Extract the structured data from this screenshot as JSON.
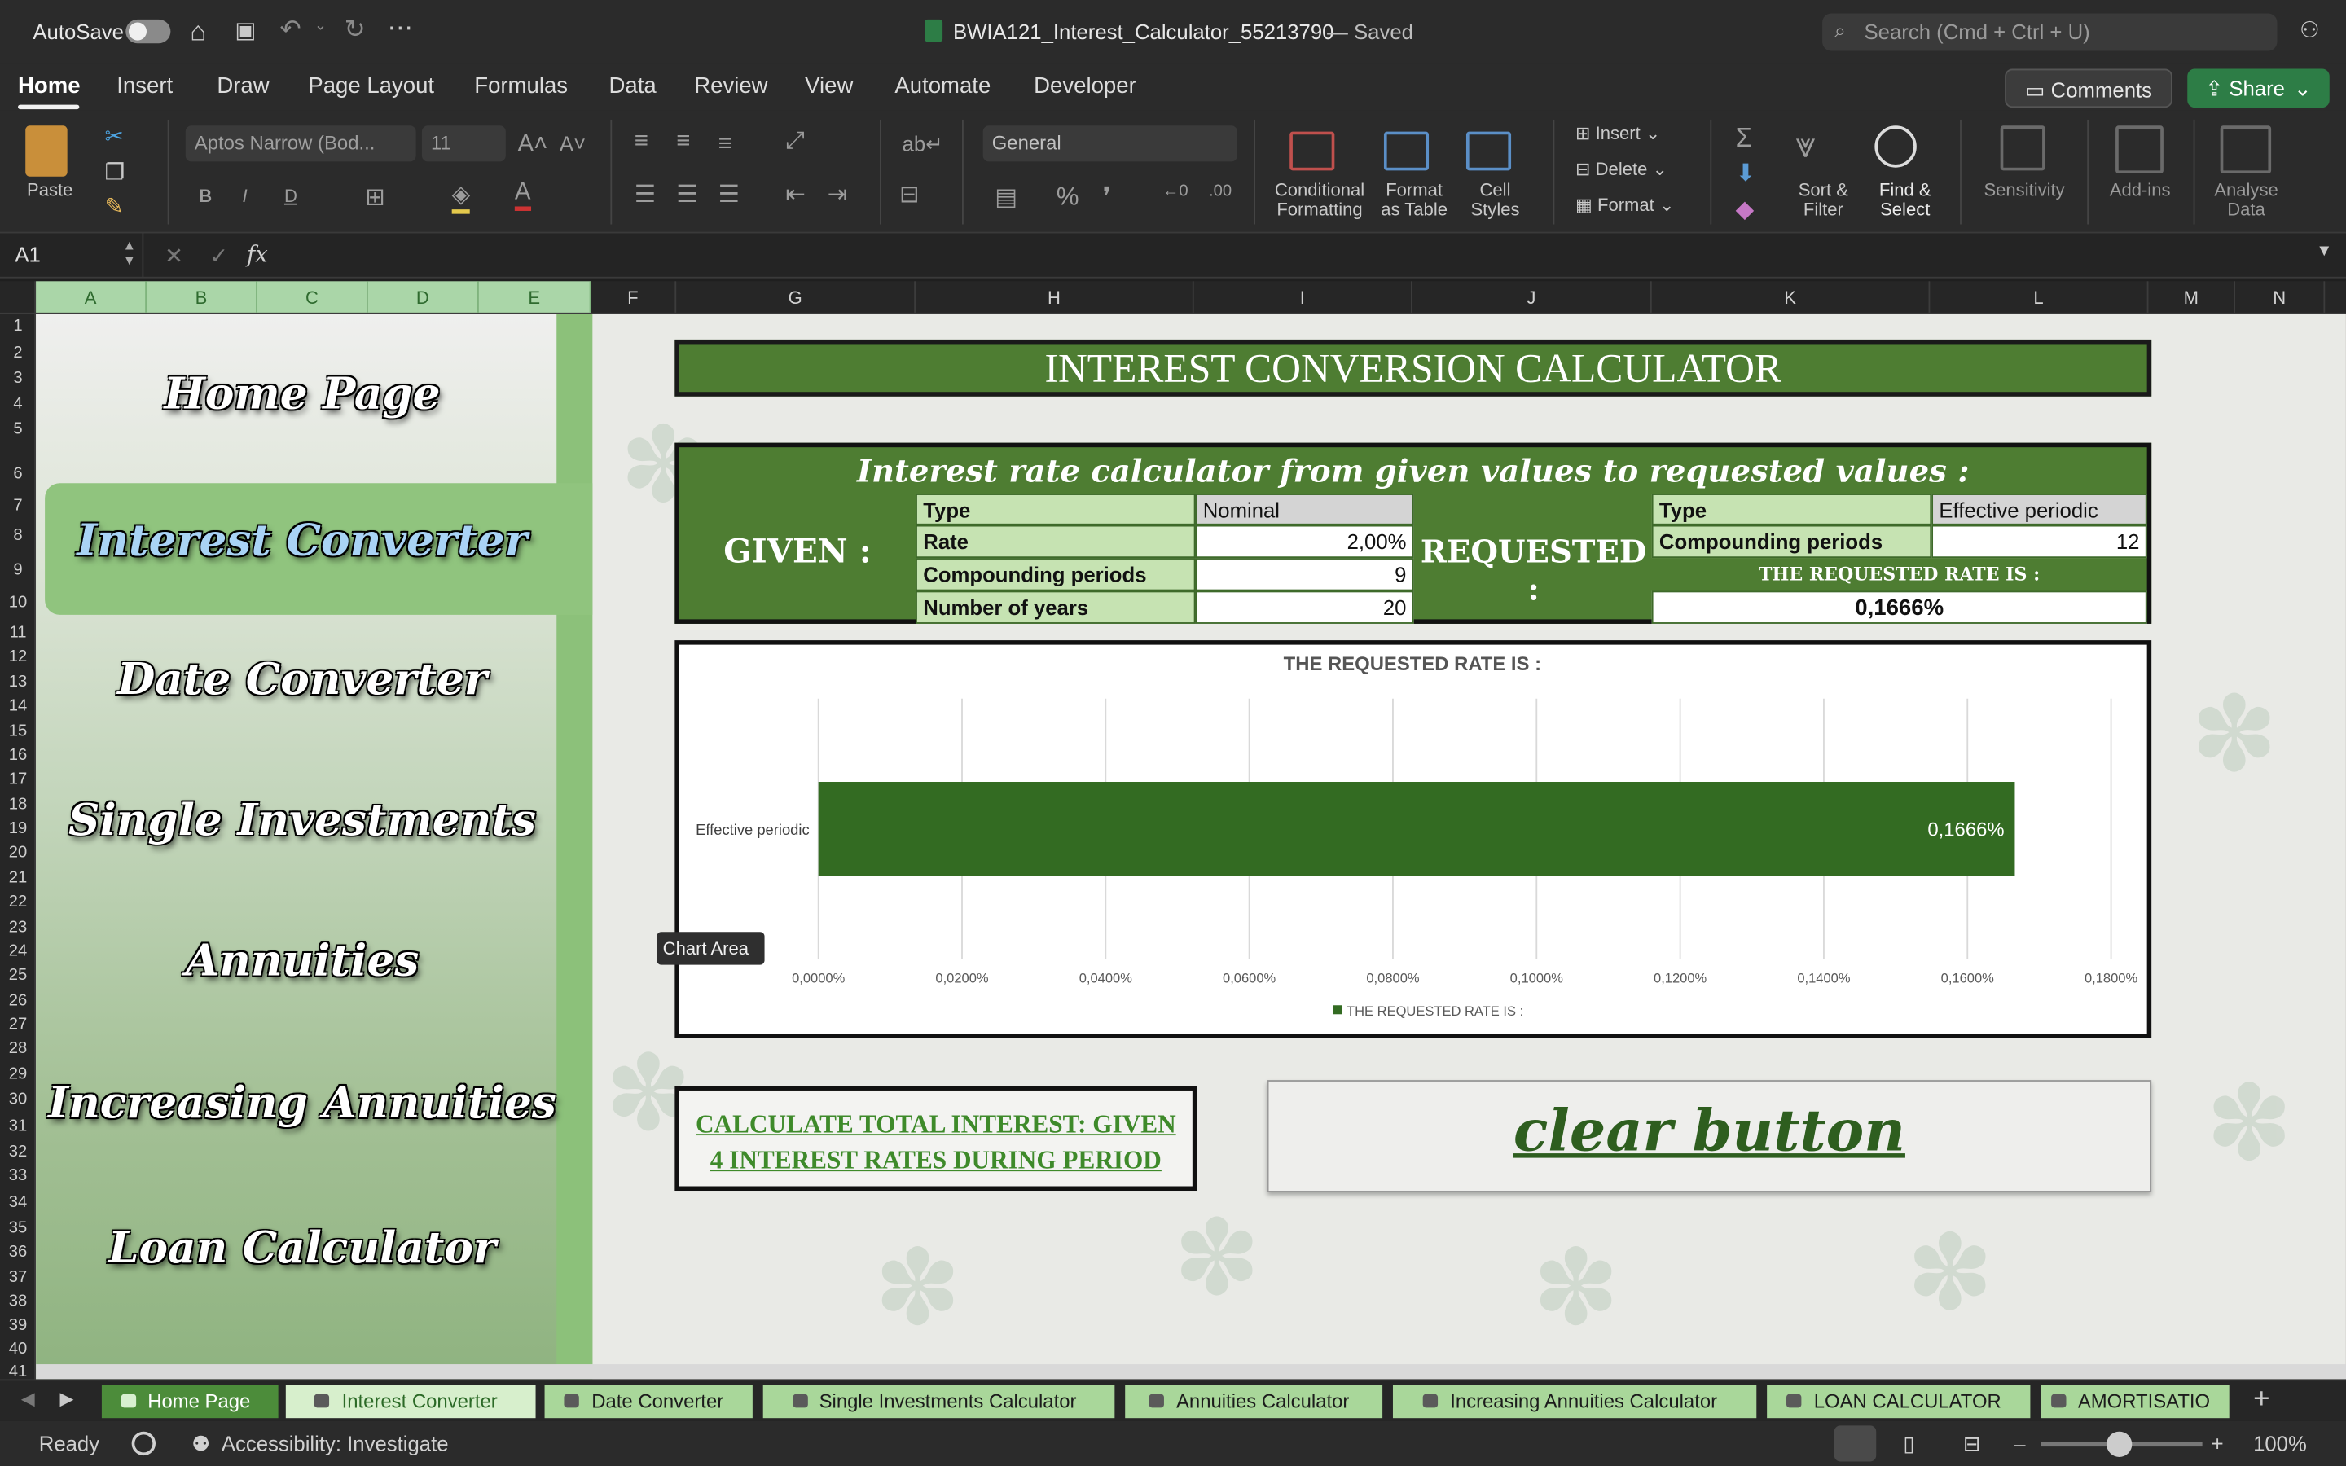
{
  "titlebar": {
    "autosave_label": "AutoSave",
    "document_title": "BWIA121_Interest_Calculator_55213790",
    "save_state": "— Saved",
    "search_placeholder": "Search (Cmd + Ctrl + U)"
  },
  "menu": {
    "tabs": [
      "Home",
      "Insert",
      "Draw",
      "Page Layout",
      "Formulas",
      "Data",
      "Review",
      "View",
      "Automate",
      "Developer"
    ],
    "active": "Home",
    "comments_label": "Comments",
    "share_label": "Share",
    "comments_color": "#3a3a3a",
    "share_color": "#2d7d46"
  },
  "ribbon": {
    "paste_label": "Paste",
    "font_name": "Aptos Narrow (Bod...",
    "font_size": "11",
    "number_format": "General",
    "conditional_formatting": [
      "Conditional",
      "Formatting"
    ],
    "format_as_table": [
      "Format",
      "as Table"
    ],
    "cell_styles": [
      "Cell",
      "Styles"
    ],
    "insert_label": "Insert",
    "delete_label": "Delete",
    "format_label": "Format",
    "sort_filter": [
      "Sort &",
      "Filter"
    ],
    "find_select": [
      "Find &",
      "Select"
    ],
    "sensitivity": "Sensitivity",
    "addins": "Add-ins",
    "analyse_data": [
      "Analyse",
      "Data"
    ]
  },
  "formula_bar": {
    "name_box": "A1",
    "fx": "fx",
    "formula": ""
  },
  "columns": [
    "A",
    "B",
    "C",
    "D",
    "E",
    "F",
    "G",
    "H",
    "I",
    "J",
    "K",
    "L",
    "M",
    "N"
  ],
  "rows": [
    "1",
    "2",
    "3",
    "4",
    "5",
    "6",
    "7",
    "8",
    "9",
    "10",
    "11",
    "12",
    "13",
    "14",
    "15",
    "16",
    "17",
    "18",
    "19",
    "20",
    "21",
    "22",
    "23",
    "24",
    "25",
    "26",
    "27",
    "28",
    "29",
    "30",
    "31",
    "32",
    "33",
    "34",
    "35",
    "36",
    "37",
    "38",
    "39",
    "40",
    "41"
  ],
  "sidebar": {
    "items": [
      "Home Page",
      "Interest Converter",
      "Date Converter",
      "Single Investments",
      "Annuities",
      "Increasing Annuities",
      "Loan Calculator"
    ],
    "active_index": 1,
    "active_color": "#90c47e"
  },
  "calculator": {
    "title": "INTEREST CONVERSION CALCULATOR",
    "subtitle": "Interest rate calculator from given values to requested values :",
    "given_label": "GIVEN :",
    "requested_label": "REQUESTED :",
    "given": [
      {
        "label": "Type",
        "value": "Nominal"
      },
      {
        "label": "Rate",
        "value": "2,00%"
      },
      {
        "label": "Compounding periods",
        "value": "9"
      },
      {
        "label": "Number of years",
        "value": "20"
      }
    ],
    "requested": [
      {
        "label": "Type",
        "value": "Effective periodic"
      },
      {
        "label": "Compounding periods",
        "value": "12"
      }
    ],
    "result_label": "THE REQUESTED RATE IS :",
    "result_value": "0,1666%",
    "theme_color": "#4e7d32"
  },
  "chart_data": {
    "type": "bar",
    "orientation": "horizontal",
    "title": "THE REQUESTED RATE IS :",
    "categories": [
      "Effective periodic"
    ],
    "series": [
      {
        "name": "THE REQUESTED RATE IS :",
        "values": [
          0.1666
        ],
        "color": "#336b22"
      }
    ],
    "data_labels": [
      "0,1666%"
    ],
    "x_ticks": [
      "0,0000%",
      "0,0200%",
      "0,0400%",
      "0,0600%",
      "0,0800%",
      "0,1000%",
      "0,1200%",
      "0,1400%",
      "0,1600%",
      "0,1800%"
    ],
    "xlim": [
      0,
      0.18
    ],
    "grid": true,
    "legend": "bottom"
  },
  "tooltip": "Chart Area",
  "buttons": {
    "total_interest": [
      "CALCULATE TOTAL INTEREST: GIVEN",
      "4 INTEREST RATES DURING PERIOD"
    ],
    "clear": "clear button"
  },
  "sheet_tabs": [
    "Home Page",
    "Interest Converter",
    "Date Converter",
    "Single Investments Calculator",
    "Annuities Calculator",
    "Increasing Annuities Calculator",
    "LOAN CALCULATOR",
    "AMORTISATIO"
  ],
  "active_sheet": "Interest Converter",
  "statusbar": {
    "ready": "Ready",
    "accessibility": "Accessibility: Investigate",
    "zoom": "100%"
  }
}
